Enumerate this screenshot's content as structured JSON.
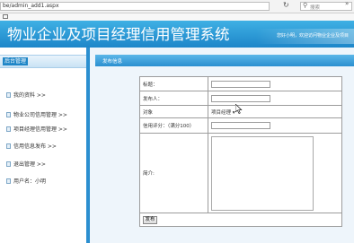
{
  "browser": {
    "url": "be/admin_add1.aspx",
    "search_placeholder": "搜索"
  },
  "header": {
    "title": "物业企业及项目经理信用管理系统",
    "welcome": "您好小明，欢迎访问物业企业及项目"
  },
  "sidebar": {
    "title": "后台管理",
    "items": [
      {
        "label": "我的资料 >>"
      },
      {
        "label": "物业公司信用管理 >>"
      },
      {
        "label": "项目经理信用管理 >>"
      },
      {
        "label": "信用信息发布 >>"
      },
      {
        "label": "退出管理 >>"
      },
      {
        "label": "用户名：小明"
      }
    ]
  },
  "content": {
    "title": "发布信息",
    "form": {
      "title_label": "标题：",
      "title_value": "",
      "publisher_label": "发布人：",
      "publisher_value": "",
      "target_label": "对象",
      "target_selected": "项目经理",
      "score_label": "信用评分：（满分100）",
      "score_value": "",
      "content_label": "简介:",
      "content_value": "",
      "publish_label": "发布"
    }
  },
  "colors": {
    "header_blue": "#1d86c9",
    "sidebar_accent": "#2b8fd0"
  }
}
